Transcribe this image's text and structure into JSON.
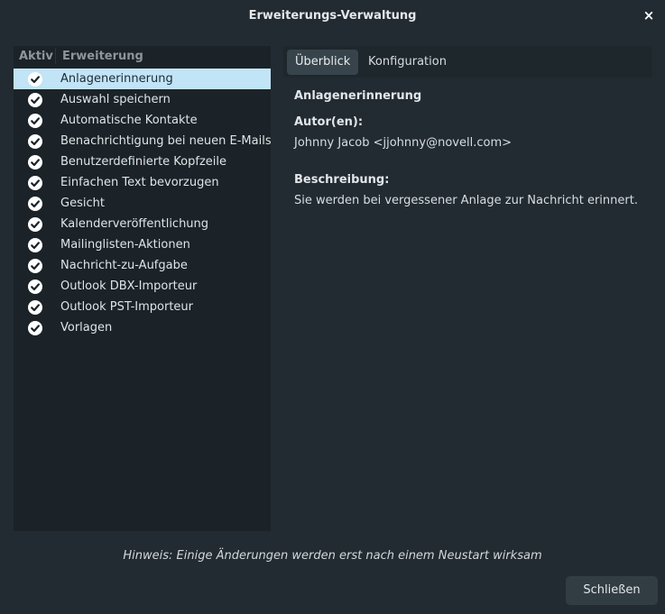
{
  "window": {
    "title": "Erweiterungs-Verwaltung",
    "close_glyph": "×"
  },
  "list": {
    "col_active": "Aktiv",
    "col_extension": "Erweiterung",
    "selected_index": 0,
    "items": [
      {
        "label": "Anlagenerinnerung",
        "active": true
      },
      {
        "label": "Auswahl speichern",
        "active": true
      },
      {
        "label": "Automatische Kontakte",
        "active": true
      },
      {
        "label": "Benachrichtigung bei neuen E-Mails",
        "active": true
      },
      {
        "label": "Benutzerdefinierte Kopfzeile",
        "active": true
      },
      {
        "label": "Einfachen Text bevorzugen",
        "active": true
      },
      {
        "label": "Gesicht",
        "active": true
      },
      {
        "label": "Kalenderveröffentlichung",
        "active": true
      },
      {
        "label": "Mailinglisten-Aktionen",
        "active": true
      },
      {
        "label": "Nachricht-zu-Aufgabe",
        "active": true
      },
      {
        "label": "Outlook DBX-Importeur",
        "active": true
      },
      {
        "label": "Outlook PST-Importeur",
        "active": true
      },
      {
        "label": "Vorlagen",
        "active": true
      }
    ]
  },
  "tabs": {
    "overview": "Überblick",
    "config": "Konfiguration"
  },
  "details": {
    "name": "Anlagenerinnerung",
    "authors_heading": "Autor(en):",
    "authors": "Johnny Jacob <jjohnny@novell.com>",
    "description_heading": "Beschreibung:",
    "description": "Sie werden bei vergessener Anlage zur Nachricht erinnert."
  },
  "footer": {
    "hint": "Hinweis: Einige Änderungen werden erst nach einem Neustart wirksam",
    "close_button": "Schließen"
  },
  "colors": {
    "background": "#222b31",
    "selection": "#c2e4f7",
    "check_fill": "#ffffff"
  },
  "icons": {
    "checkbox": "checkmark-circle-icon",
    "close": "close-icon"
  }
}
